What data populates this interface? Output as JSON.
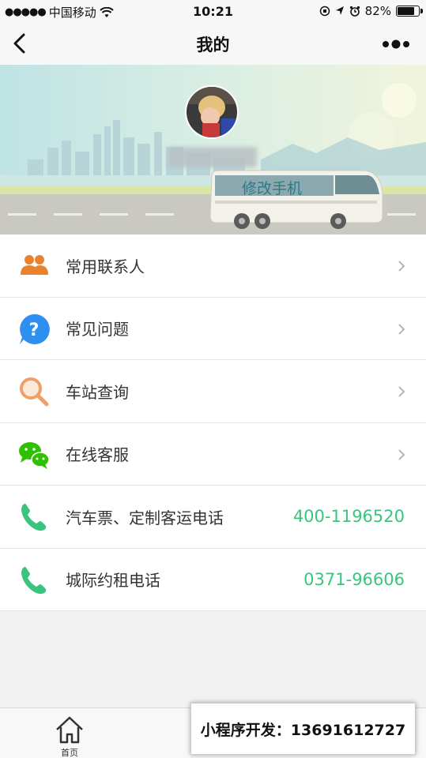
{
  "status_bar": {
    "signal": "●●●●●",
    "carrier": "中国移动",
    "time": "10:21",
    "battery_text": "82%",
    "battery_level": 0.82
  },
  "nav": {
    "title": "我的"
  },
  "profile": {
    "modify_phone": "修改手机"
  },
  "menu": [
    {
      "label": "常用联系人",
      "icon": "contacts-icon",
      "color": "#e8822e"
    },
    {
      "label": "常见问题",
      "icon": "help-icon",
      "color": "#2d8ff0"
    },
    {
      "label": "车站查询",
      "icon": "search-icon",
      "color": "#eea06a"
    },
    {
      "label": "在线客服",
      "icon": "wechat-icon",
      "color": "#2dc100"
    }
  ],
  "phones": [
    {
      "label": "汽车票、定制客运电话",
      "value": "400-1196520",
      "icon": "phone-icon"
    },
    {
      "label": "城际约租电话",
      "value": "0371-96606",
      "icon": "phone-icon"
    }
  ],
  "tab_bar": {
    "home_label": "首页"
  },
  "promo": {
    "text": "小程序开发：13691612727"
  },
  "colors": {
    "accent_green": "#3ac47d",
    "background": "#f2f2f2"
  }
}
